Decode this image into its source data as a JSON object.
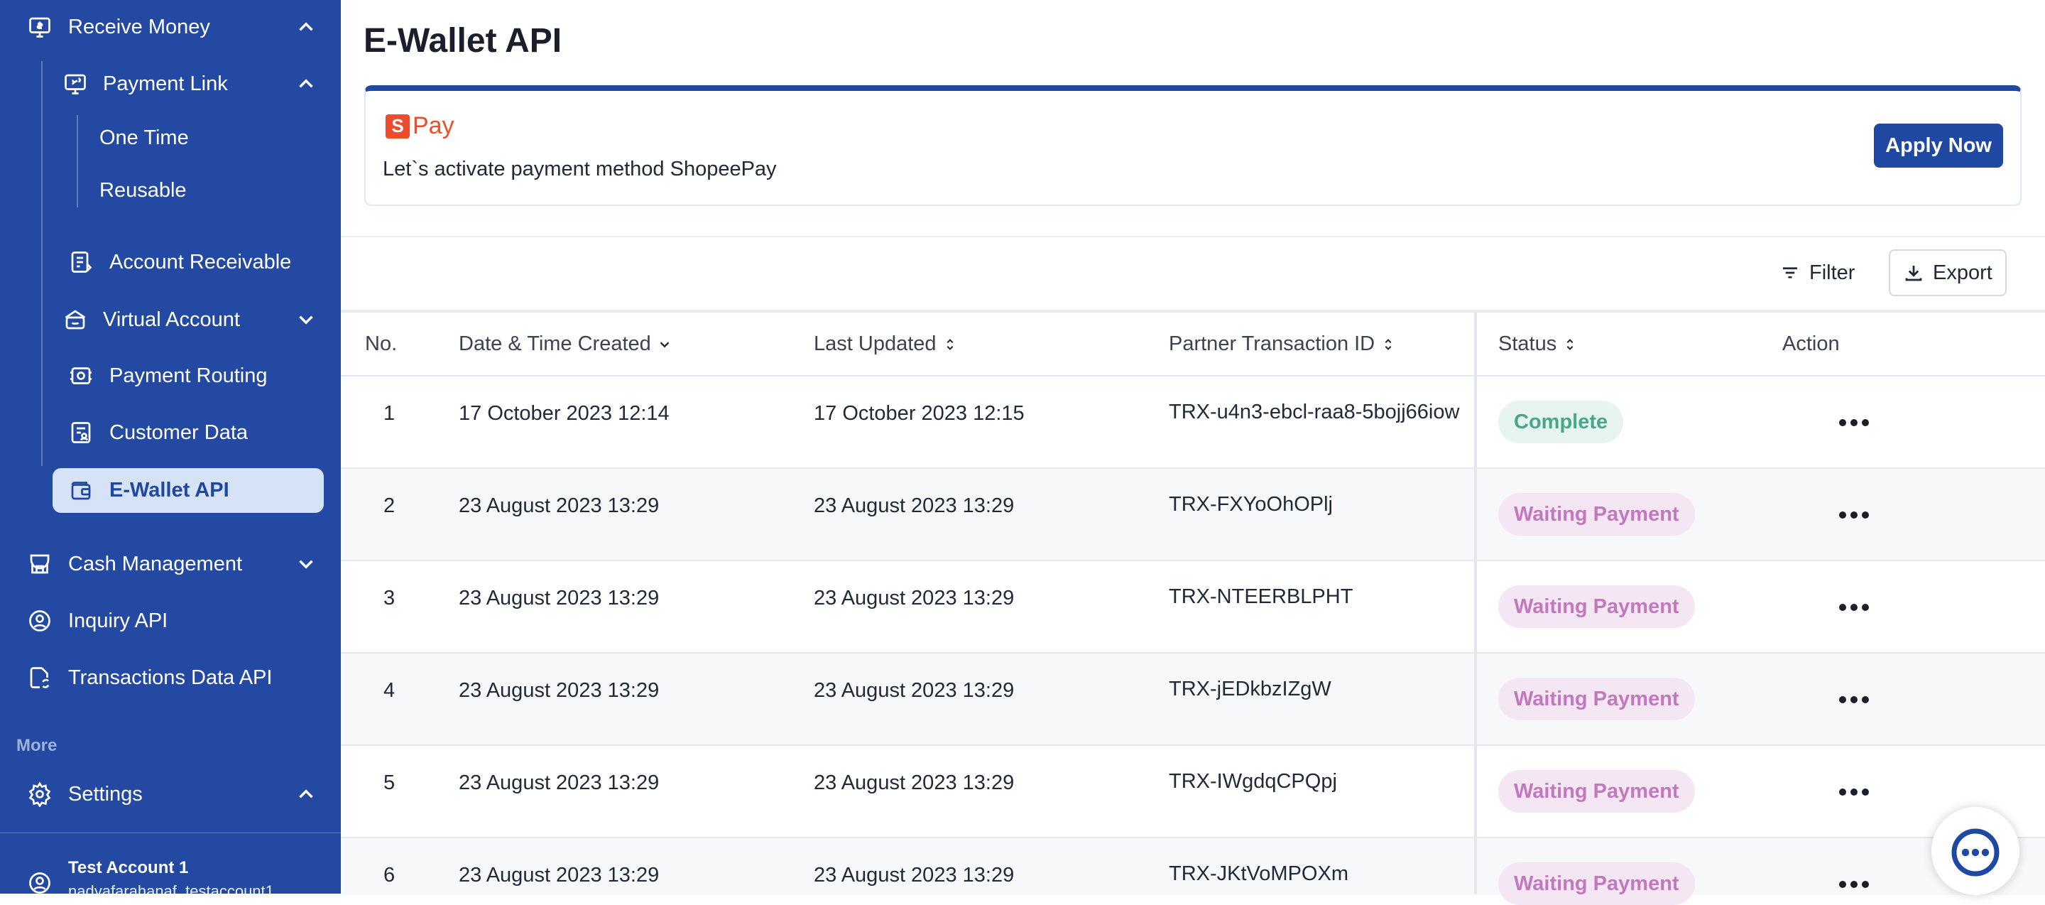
{
  "sidebar": {
    "receive_money": "Receive Money",
    "payment_link": "Payment Link",
    "one_time": "One Time",
    "reusable": "Reusable",
    "account_receivable": "Account Receivable",
    "virtual_account": "Virtual Account",
    "payment_routing": "Payment Routing",
    "customer_data": "Customer Data",
    "ewallet_api": "E-Wallet API",
    "cash_management": "Cash Management",
    "inquiry_api": "Inquiry API",
    "transactions_data_api": "Transactions Data API",
    "more_label": "More",
    "settings": "Settings",
    "account_name": "Test Account 1",
    "account_email": "nadyafarahanaf_testaccount1"
  },
  "page": {
    "title": "E-Wallet API"
  },
  "banner": {
    "logo_letter": "S",
    "logo_word": "Pay",
    "message": "Let`s activate payment method ShopeePay",
    "apply_label": "Apply Now"
  },
  "toolbar": {
    "filter_label": "Filter",
    "export_label": "Export"
  },
  "table": {
    "headers": {
      "no": "No.",
      "created": "Date & Time Created",
      "updated": "Last Updated",
      "partner_id": "Partner Transaction ID",
      "status": "Status",
      "action": "Action"
    },
    "rows": [
      {
        "no": "1",
        "created": "17 October 2023 12:14",
        "updated": "17 October 2023 12:15",
        "partner_id": "TRX-u4n3-ebcl-raa8-5bojj66iow",
        "status": "Complete"
      },
      {
        "no": "2",
        "created": "23 August 2023 13:29",
        "updated": "23 August 2023 13:29",
        "partner_id": "TRX-FXYoOhOPlj",
        "status": "Waiting Payment"
      },
      {
        "no": "3",
        "created": "23 August 2023 13:29",
        "updated": "23 August 2023 13:29",
        "partner_id": "TRX-NTEERBLPHT",
        "status": "Waiting Payment"
      },
      {
        "no": "4",
        "created": "23 August 2023 13:29",
        "updated": "23 August 2023 13:29",
        "partner_id": "TRX-jEDkbzIZgW",
        "status": "Waiting Payment"
      },
      {
        "no": "5",
        "created": "23 August 2023 13:29",
        "updated": "23 August 2023 13:29",
        "partner_id": "TRX-IWgdqCPQpj",
        "status": "Waiting Payment"
      },
      {
        "no": "6",
        "created": "23 August 2023 13:29",
        "updated": "23 August 2023 13:29",
        "partner_id": "TRX-JKtVoMPOXm",
        "status": "Waiting Payment"
      }
    ]
  },
  "colors": {
    "sidebar_bg": "#2349a3",
    "primary": "#1f48a3",
    "complete": "#4aa58a",
    "waiting": "#c278bd",
    "shopee": "#ee4d2d"
  },
  "icons": {
    "receive_money": "monitor-money-icon",
    "payment_link": "monitor-link-icon",
    "account_receivable": "document-icon",
    "virtual_account": "bank-icon",
    "payment_routing": "routing-icon",
    "customer_data": "customer-card-icon",
    "ewallet_api": "wallet-icon",
    "cash_management": "store-icon",
    "inquiry_api": "user-circle-icon",
    "transactions_data_api": "file-sync-icon",
    "settings": "gear-icon",
    "filter": "filter-icon",
    "export": "download-icon",
    "chat": "chat-icon"
  }
}
